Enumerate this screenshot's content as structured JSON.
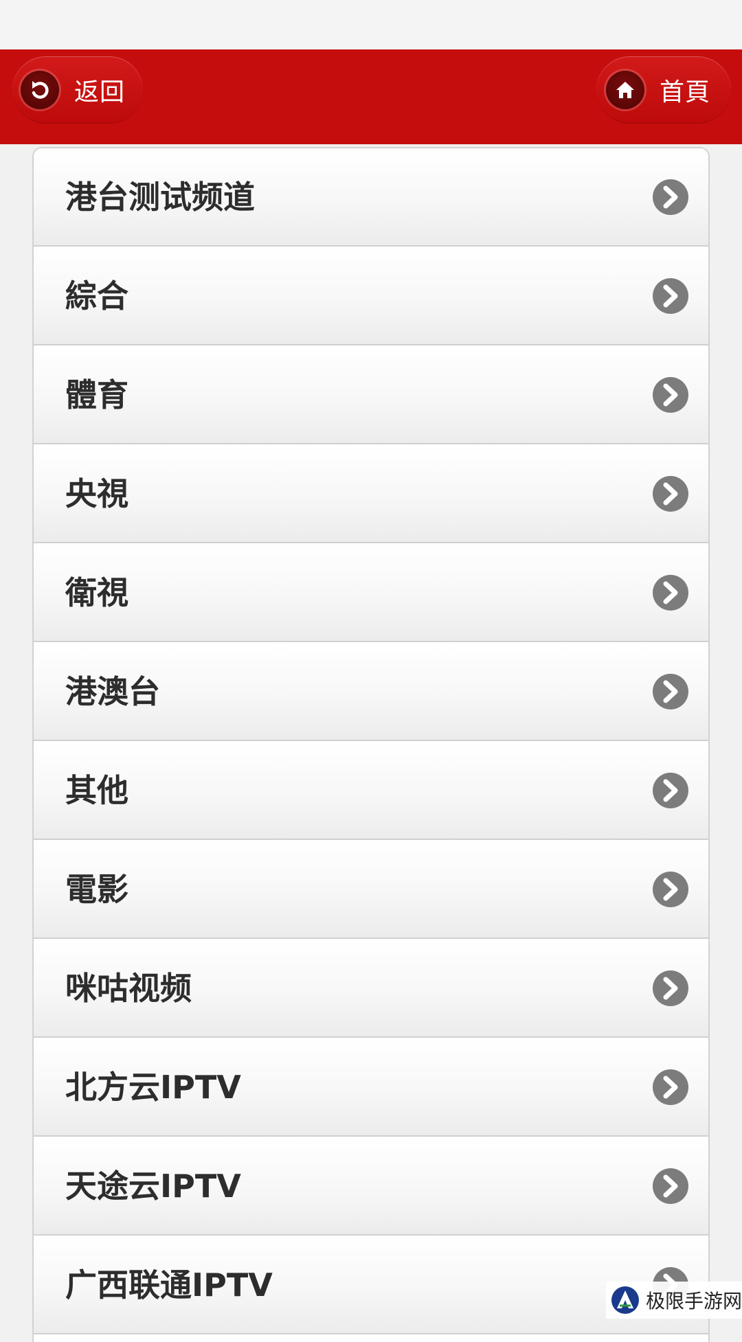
{
  "header": {
    "back_label": "返回",
    "home_label": "首頁",
    "back_icon": "back-arrow-icon",
    "home_icon": "home-icon",
    "color": "#c60d0d"
  },
  "list": {
    "items": [
      {
        "label": "港台测试频道"
      },
      {
        "label": "綜合"
      },
      {
        "label": "體育"
      },
      {
        "label": "央視"
      },
      {
        "label": "衛視"
      },
      {
        "label": "港澳台"
      },
      {
        "label": "其他"
      },
      {
        "label": "電影"
      },
      {
        "label": "咪咕视频"
      },
      {
        "label": "北方云IPTV"
      },
      {
        "label": "天途云IPTV"
      },
      {
        "label": "广西联通IPTV"
      }
    ],
    "item_icon": "chevron-right-icon"
  },
  "watermark": {
    "text": "极限手游网"
  }
}
